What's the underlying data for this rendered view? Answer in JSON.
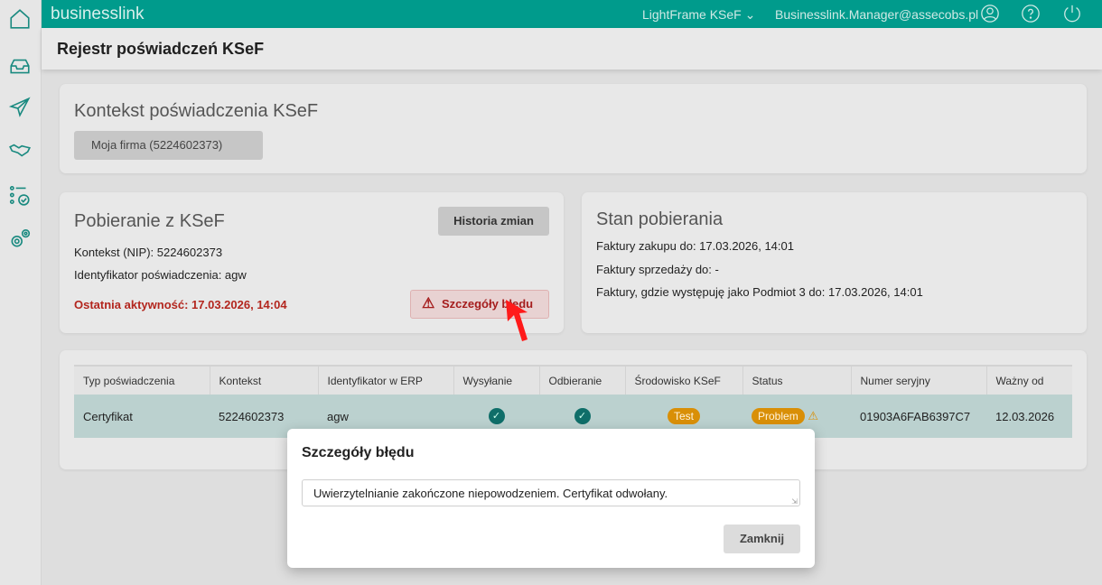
{
  "sidebar": {
    "items": [
      "home-icon",
      "inbox-icon",
      "send-icon",
      "handshake-icon",
      "checklist-icon",
      "settings-icon"
    ]
  },
  "topbar": {
    "brand": "businesslink",
    "app": "LightFrame KSeF",
    "user": "Businesslink.Manager@assecobs.pl"
  },
  "page": {
    "title": "Rejestr poświadczeń KSeF"
  },
  "context": {
    "title": "Kontekst poświadczenia KSeF",
    "selected": "Moja firma (5224602373)"
  },
  "download": {
    "title": "Pobieranie z KSeF",
    "history_btn": "Historia zmian",
    "nip": "Kontekst (NIP): 5224602373",
    "ident": "Identyfikator poświadczenia: agw",
    "last": "Ostatnia aktywność: 17.03.2026, 14:04",
    "error_btn": "Szczegóły błędu"
  },
  "status": {
    "title": "Stan pobierania",
    "lines": [
      "Faktury zakupu do: 17.03.2026, 14:01",
      "Faktury sprzedaży do: -",
      "Faktury, gdzie występuję jako Podmiot 3 do: 17.03.2026, 14:01"
    ]
  },
  "table": {
    "headers": [
      "Typ poświadczenia",
      "Kontekst",
      "Identyfikator w ERP",
      "Wysyłanie",
      "Odbieranie",
      "Środowisko KSeF",
      "Status",
      "Numer seryjny",
      "Ważny od"
    ],
    "row": {
      "type": "Certyfikat",
      "context": "5224602373",
      "erp": "agw",
      "env": "Test",
      "status": "Problem",
      "serial": "01903A6FAB6397C7",
      "valid": "12.03.2026"
    }
  },
  "modal": {
    "title": "Szczegóły błędu",
    "message": "Uwierzytelnianie zakończone niepowodzeniem. Certyfikat odwołany.",
    "close": "Zamknij"
  },
  "colors": {
    "brand": "#009b8c",
    "error": "#b3261e",
    "pill": "#d98f07"
  }
}
